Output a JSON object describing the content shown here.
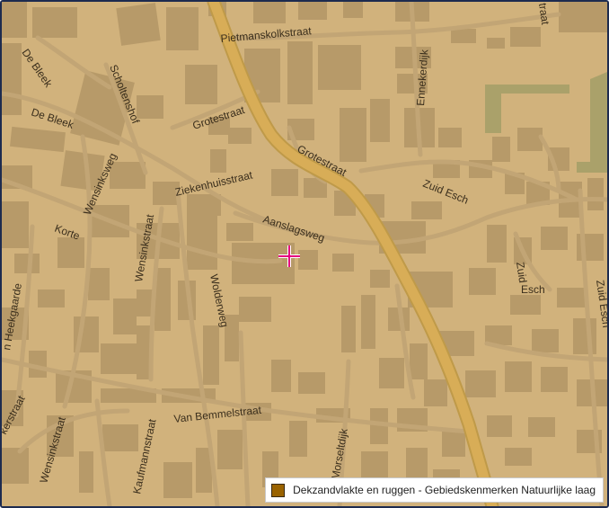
{
  "map": {
    "colors": {
      "background": "#d1b27c",
      "building": "#b79a69",
      "road_casing": "#c2a575",
      "main_road": "#d2a752",
      "green_area": "#aaa16a",
      "marker": "#e5007e"
    },
    "streets": [
      {
        "id": "pietmanskolkstraat",
        "name": "Pietmanskolkstraat"
      },
      {
        "id": "de-bleek-top",
        "name": "De Bleek"
      },
      {
        "id": "scholtenshof",
        "name": "Scholtenshof"
      },
      {
        "id": "ennekerdijk",
        "name": "Ennekerdijk"
      },
      {
        "id": "grotestraat-1",
        "name": "Grotestraat"
      },
      {
        "id": "grotestraat-2",
        "name": "Grotestraat"
      },
      {
        "id": "de-bleek",
        "name": "De Bleek"
      },
      {
        "id": "wensinksweg-upper",
        "name": "Wensinksweg"
      },
      {
        "id": "ziekenhuisstraat",
        "name": "Ziekenhuisstraat"
      },
      {
        "id": "zuid-esch",
        "name": "Zuid Esch"
      },
      {
        "id": "korte",
        "name": "Korte"
      },
      {
        "id": "aanslagsweg",
        "name": "Aanslagsweg"
      },
      {
        "id": "wensinkstraat-1",
        "name": "Wensinkstraat"
      },
      {
        "id": "zuid-vertical",
        "name": "Zuid"
      },
      {
        "id": "esch",
        "name": "Esch"
      },
      {
        "id": "zuid-esch-right",
        "name": "Zuid Esch"
      },
      {
        "id": "heekgaarde",
        "name": "n Heekgaarde"
      },
      {
        "id": "wolderweg",
        "name": "Wolderweg"
      },
      {
        "id": "kerstraat",
        "name": "kerstraat"
      },
      {
        "id": "van-bemmelstraat",
        "name": "Van Bemmelstraat"
      },
      {
        "id": "wensinkstraat-2",
        "name": "Wensinkstraat"
      },
      {
        "id": "kaufmannstraat",
        "name": "Kaufmannstraat"
      },
      {
        "id": "morseltdijk",
        "name": "Morseltdijk"
      },
      {
        "id": "straat-top-right",
        "name": "traat"
      }
    ]
  },
  "legend": {
    "label": "Dekzandvlakte en ruggen - Gebiedskenmerken Natuurlijke laag",
    "swatch_color": "#9a6300"
  }
}
